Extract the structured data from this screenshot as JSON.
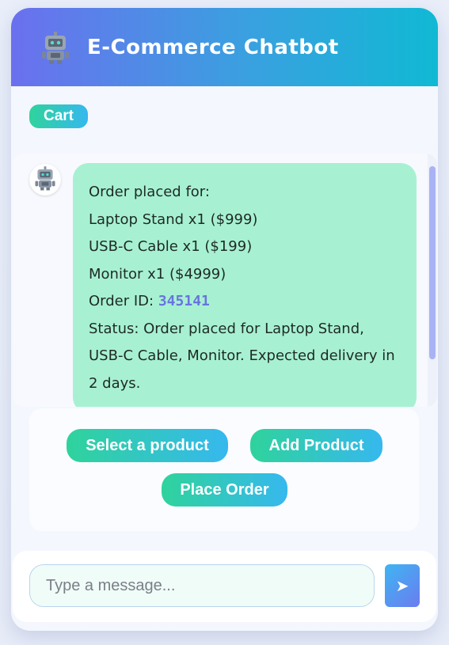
{
  "header": {
    "title": "E-Commerce Chatbot",
    "icon": "robot-icon"
  },
  "cart": {
    "label": "Cart"
  },
  "messages": [
    {
      "sender": "bot",
      "avatar_icon": "robot-icon",
      "lines": {
        "l0": "Order placed for:",
        "l1": "Laptop Stand x1 ($999)",
        "l2": "USB-C Cable x1 ($199)",
        "l3": "Monitor x1 ($4999)",
        "order_id_label": "Order ID: ",
        "order_id": "345141",
        "status": "Status: Order placed for Laptop Stand, USB-C Cable, Monitor. Expected delivery in 2 days."
      }
    }
  ],
  "actions": {
    "select": "Select a product",
    "add": "Add Product",
    "place": "Place Order"
  },
  "composer": {
    "placeholder": "Type a message...",
    "send_icon": "send-arrow-icon",
    "send_glyph": "➤"
  },
  "colors": {
    "header_start": "#6b70ee",
    "header_end": "#10b9d4",
    "bubble_bg": "#a7f1d2",
    "button_start": "#2fd39c",
    "button_end": "#36b8ee",
    "order_id": "#6a73e0"
  }
}
